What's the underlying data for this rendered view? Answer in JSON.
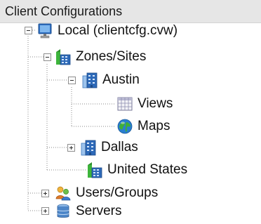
{
  "header": {
    "title": "Client Configurations"
  },
  "tree": {
    "root": {
      "label": "Local (clientcfg.cvw)",
      "icon": "computer-icon",
      "expanded": true
    },
    "zones": {
      "label": "Zones/Sites",
      "icon": "zones-sites-icon",
      "expanded": true
    },
    "austin": {
      "label": "Austin",
      "icon": "building-icon",
      "expanded": true
    },
    "views": {
      "label": "Views",
      "icon": "grid-views-icon"
    },
    "maps": {
      "label": "Maps",
      "icon": "globe-icon"
    },
    "dallas": {
      "label": "Dallas",
      "icon": "building-icon",
      "expanded": false
    },
    "united_states": {
      "label": "United States",
      "icon": "zones-sites-icon"
    },
    "users_groups": {
      "label": "Users/Groups",
      "icon": "users-icon",
      "expanded": false
    },
    "servers": {
      "label": "Servers",
      "icon": "server-icon",
      "expanded": false
    }
  }
}
